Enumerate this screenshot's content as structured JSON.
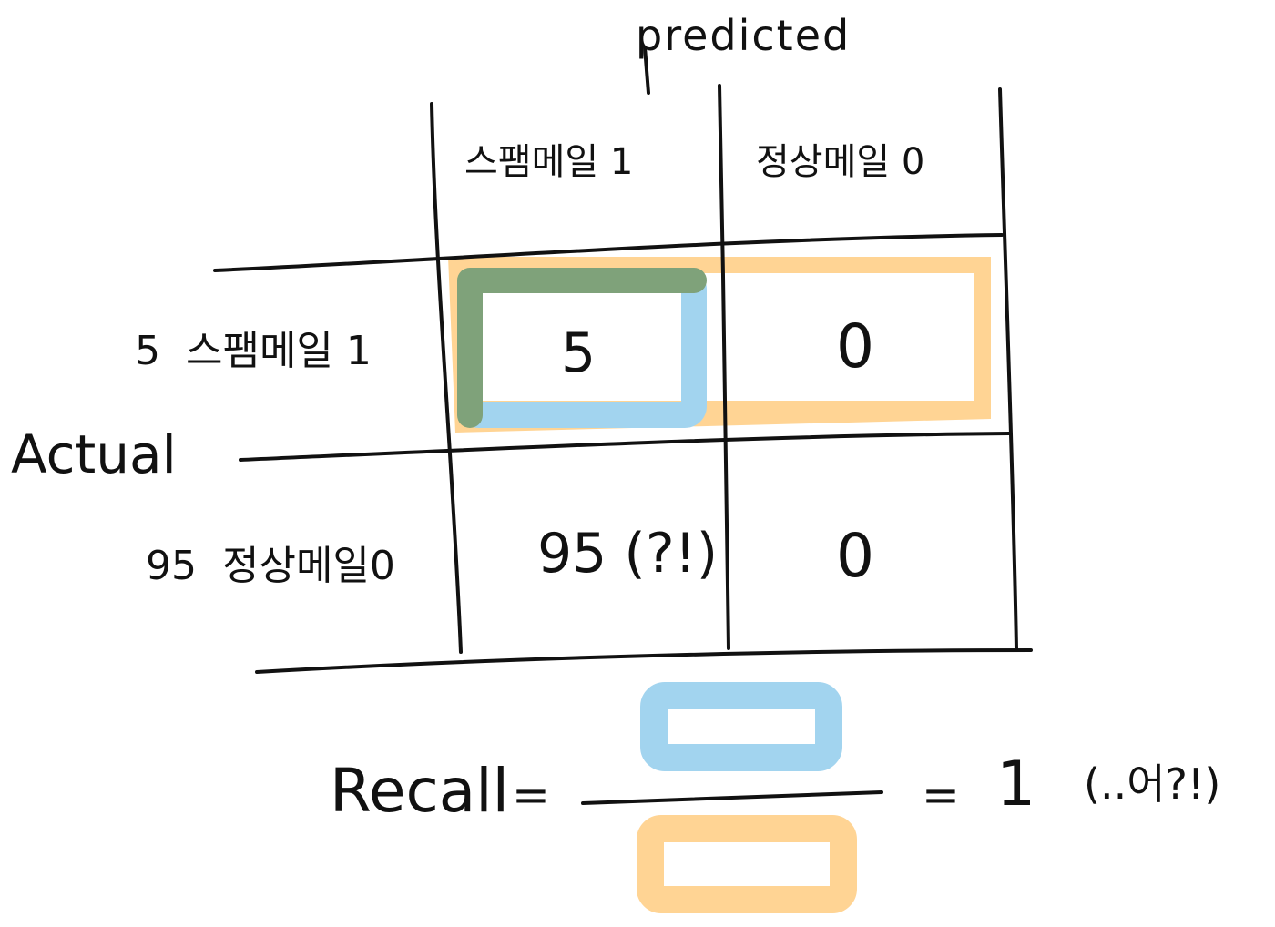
{
  "diagram": {
    "predicted_label": "predicted",
    "columns": [
      "스팸메일 1",
      "정상메일 0"
    ],
    "actual_label": "Actual",
    "rows": [
      {
        "count": "5",
        "label": "스팸메일 1"
      },
      {
        "count": "95",
        "label": "정상메일0"
      }
    ],
    "cells": [
      [
        "5",
        "0"
      ],
      [
        "95 (?!)",
        "0"
      ]
    ],
    "formula": {
      "name": "Recall",
      "equals": "=",
      "result": "1",
      "remark": "(..어?!)"
    },
    "colors": {
      "ink": "#111111",
      "highlight_blue": "#a2d4ef",
      "highlight_orange": "#ffd494",
      "overlap_green": "#7fa27a"
    }
  }
}
